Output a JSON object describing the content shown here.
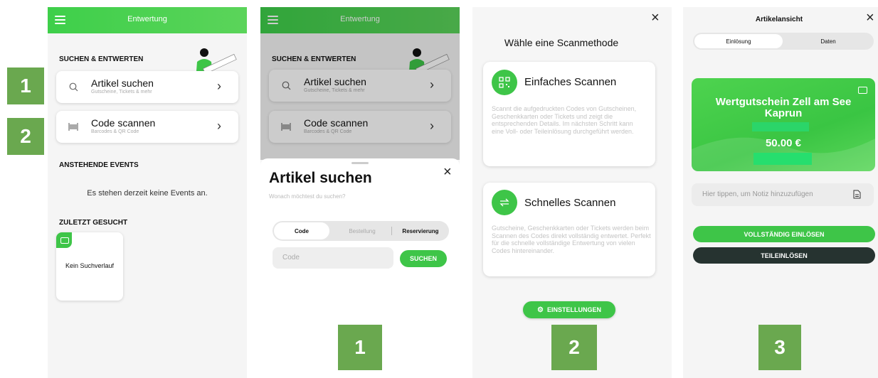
{
  "labels": {
    "side1": "1",
    "side2": "2",
    "bottom1": "1",
    "bottom2": "2",
    "bottom3": "3"
  },
  "screen1": {
    "header_title": "Entwertung",
    "section_search": "SUCHEN & ENTWERTEN",
    "artikel_title": "Artikel suchen",
    "artikel_sub": "Gutscheine, Tickets & mehr",
    "code_title": "Code scannen",
    "code_sub": "Barcodes & QR Code",
    "section_events": "ANSTEHENDE EVENTS",
    "no_events": "Es stehen derzeit keine Events an.",
    "section_recent": "ZULETZT GESUCHT",
    "no_history": "Kein Suchverlauf"
  },
  "screen2": {
    "header_title": "Entwertung",
    "section_search": "SUCHEN & ENTWERTEN",
    "artikel_title": "Artikel suchen",
    "artikel_sub": "Gutscheine, Tickets & mehr",
    "code_title": "Code scannen",
    "code_sub": "Barcodes & QR Code",
    "sheet_title": "Artikel suchen",
    "sheet_sub": "Wonach möchtest du suchen?",
    "tabs": [
      "Code",
      "Bestellung",
      "Reservierung"
    ],
    "input_placeholder": "Code",
    "search_button": "SUCHEN"
  },
  "screen3": {
    "title": "Wähle eine Scanmethode",
    "m1_title": "Einfaches Scannen",
    "m1_desc": "Scannt die aufgedruckten Codes von Gutscheinen, Geschenkkarten oder Tickets und zeigt die entsprechenden Details. Im nächsten Schritt kann eine Voll- oder Teileinlösung durchgeführt werden.",
    "m2_title": "Schnelles Scannen",
    "m2_desc": "Gutscheine, Geschenkkarten oder Tickets werden beim Scannen des Codes direkt vollständig entwertet. Perfekt für die schnelle vollständige Entwertung von vielen Codes hintereinander.",
    "settings_button": "EINSTELLUNGEN"
  },
  "screen4": {
    "title": "Artikelansicht",
    "tabs": [
      "Einlösung",
      "Daten"
    ],
    "voucher_title": "Wertgutschein Zell am See Kaprun",
    "voucher_amount": "50.00 €",
    "note_placeholder": "Hier tippen, um Notiz hinzuzufügen",
    "full_redeem": "VOLLSTÄNDIG EINLÖSEN",
    "partial_redeem": "TEILEINLÖSEN"
  },
  "colors": {
    "green": "#3ec548",
    "label_green": "#6aa84f",
    "dark_button": "#263330"
  }
}
